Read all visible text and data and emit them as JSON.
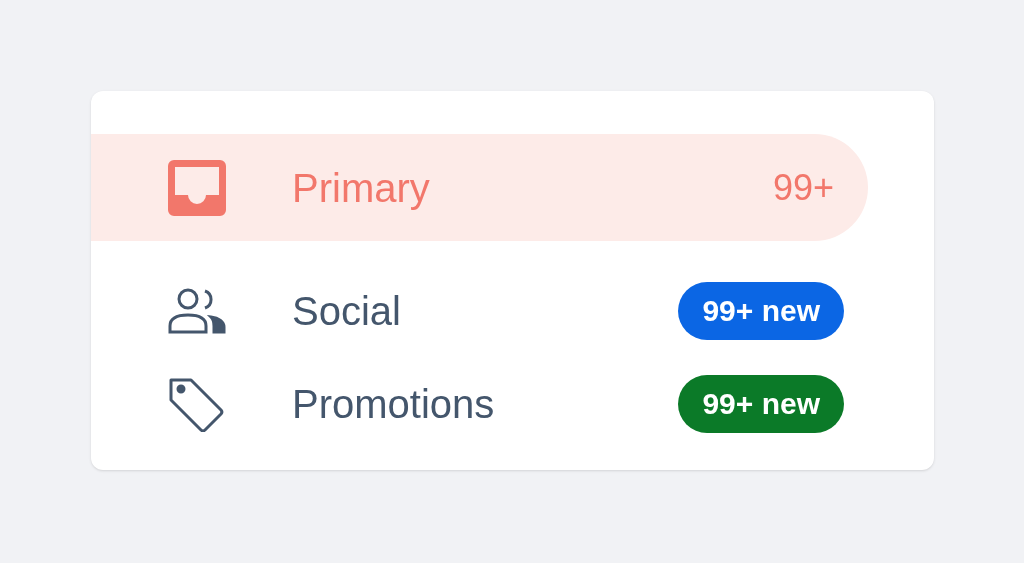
{
  "categories": [
    {
      "kind": "inbox",
      "label": "Primary",
      "selected": true,
      "count": "99+"
    },
    {
      "kind": "people",
      "label": "Social",
      "selected": false,
      "count": "99+ new",
      "color": "#0b66e4"
    },
    {
      "kind": "tag",
      "label": "Promotions",
      "selected": false,
      "count": "99+ new",
      "color": "#0b7a28"
    }
  ]
}
